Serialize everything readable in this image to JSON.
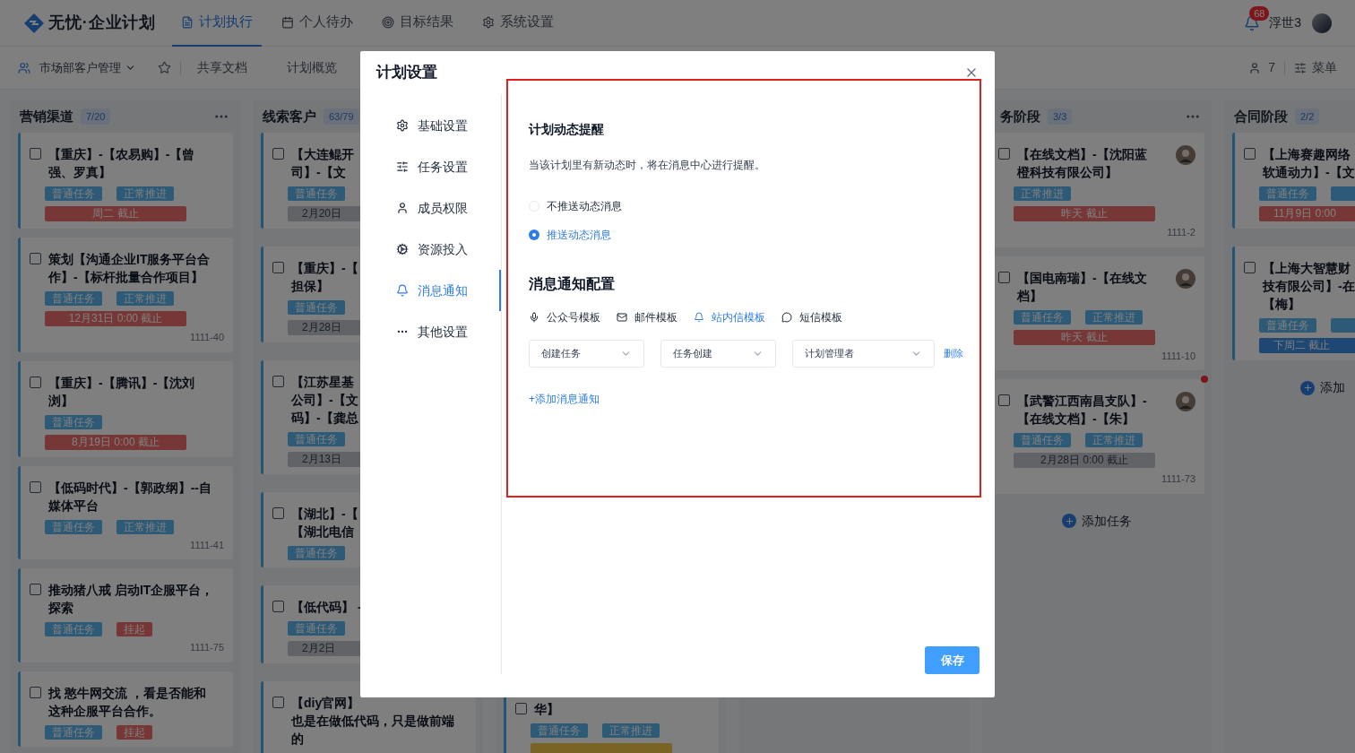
{
  "header": {
    "logo": "无忧·企业计划",
    "nav": [
      {
        "label": "计划执行",
        "selected": true
      },
      {
        "label": "个人待办",
        "selected": false
      },
      {
        "label": "目标结果",
        "selected": false
      },
      {
        "label": "系统设置",
        "selected": false
      }
    ],
    "badge": "68",
    "user": "浮世3"
  },
  "subbar": {
    "project": "市场部客户管理",
    "links": [
      "共享文档",
      "计划概览"
    ],
    "members": "7",
    "menu": "菜单"
  },
  "columns": [
    {
      "kind": "full",
      "title": "营销渠道",
      "count": "7/20",
      "more_button": true,
      "cards": [
        {
          "checked": false,
          "lines": [
            "【重庆】-【农易购】-【曾",
            "强、罗真】"
          ],
          "tags": [
            {
              "text": "普通任务",
              "kind": "normal"
            },
            {
              "text": "正常推进",
              "kind": "normal"
            }
          ],
          "due": {
            "text": "周二 截止",
            "kind": "red"
          }
        },
        {
          "checked": false,
          "lines": [
            "策划【沟通企业IT服务平台合",
            "作】-【标杆批量合作项目】"
          ],
          "tags": [
            {
              "text": "普通任务",
              "kind": "normal"
            },
            {
              "text": "正常推进",
              "kind": "normal"
            }
          ],
          "due": {
            "text": "12月31日 0:00 截止",
            "kind": "red"
          },
          "code": "1111-40"
        },
        {
          "checked": false,
          "lines": [
            "【重庆】-【腾讯】-【沈刘",
            "浏】"
          ],
          "tags": [
            {
              "text": "普通任务",
              "kind": "normal"
            }
          ],
          "due": {
            "text": "8月19日 0:00 截止",
            "kind": "red"
          }
        },
        {
          "checked": false,
          "lines": [
            "【低码时代】-【郭政纲】--自",
            "媒体平台"
          ],
          "tags": [
            {
              "text": "普通任务",
              "kind": "normal"
            },
            {
              "text": "正常推进",
              "kind": "normal"
            }
          ],
          "code": "1111-41"
        },
        {
          "checked": false,
          "lines": [
            "推动猪八戒 启动IT企服平台，",
            "探索"
          ],
          "tags": [
            {
              "text": "普通任务",
              "kind": "normal"
            },
            {
              "text": "挂起",
              "kind": "paused"
            }
          ],
          "code": "1111-75"
        },
        {
          "checked": false,
          "lines": [
            "找 憨牛网交流 ，看是否能和",
            "这种企服平台合作。"
          ],
          "tags": [
            {
              "text": "普通任务",
              "kind": "normal"
            },
            {
              "text": "挂起",
              "kind": "paused"
            }
          ]
        }
      ]
    },
    {
      "kind": "clipped_right",
      "title": "线索客户",
      "count": "63/79",
      "cards": [
        {
          "checked": false,
          "lines": [
            "【大连鲲开",
            "司】-【文"
          ],
          "tags": [
            {
              "text": "普通任务",
              "kind": "normal"
            }
          ],
          "due": {
            "text": "2月20日",
            "kind": "gray"
          }
        },
        {
          "checked": false,
          "lines": [
            "【重庆】-【",
            "担保】"
          ],
          "tags": [
            {
              "text": "普通任务",
              "kind": "normal"
            }
          ],
          "due": {
            "text": "2月28日",
            "kind": "gray"
          }
        },
        {
          "checked": false,
          "lines": [
            "【江苏星基",
            "公司】-【文",
            "码】-【龚总"
          ],
          "tags": [
            {
              "text": "普通任务",
              "kind": "normal"
            }
          ],
          "due": {
            "text": "2月13日",
            "kind": "gray"
          }
        },
        {
          "checked": false,
          "lines": [
            "【湖北】-【",
            "【湖北电信"
          ],
          "tags": [
            {
              "text": "普通任务",
              "kind": "normal"
            }
          ]
        },
        {
          "checked": false,
          "lines": [
            "【低代码】 -"
          ],
          "tags": [
            {
              "text": "普通任务",
              "kind": "normal"
            }
          ],
          "due": {
            "text": "2月2日",
            "kind": "gray"
          }
        },
        {
          "checked": false,
          "lines": [
            "【diy官网】",
            "也是在做低代码，只是做前端",
            "的"
          ]
        }
      ]
    },
    {
      "kind": "bottom_fragment",
      "cards": [
        {
          "checked": false,
          "lines": [
            "华】"
          ],
          "tags": [
            {
              "text": "普通任务",
              "kind": "normal"
            },
            {
              "text": "正常推进",
              "kind": "normal"
            }
          ],
          "due": {
            "kind": "yellow"
          }
        }
      ]
    },
    {
      "kind": "empty"
    },
    {
      "kind": "clipped_left",
      "title": "务阶段",
      "count": "3/3",
      "more_button": true,
      "cards": [
        {
          "checked": false,
          "lines": [
            "【在线文档】-【沈阳蓝",
            "橙科技有限公司】"
          ],
          "assignee_avatar": true,
          "unread": false,
          "tags": [
            {
              "text": "正常推进",
              "kind": "normal"
            }
          ],
          "due": {
            "text": "昨天 截止",
            "kind": "red"
          },
          "code": "1111-2"
        },
        {
          "checked": false,
          "lines": [
            "【国电南瑞】-【在线文",
            "档】"
          ],
          "assignee_avatar": true,
          "unread": false,
          "tags": [
            {
              "text": "普通任务",
              "kind": "normal"
            },
            {
              "text": "正常推进",
              "kind": "normal"
            }
          ],
          "due": {
            "text": "昨天 截止",
            "kind": "red"
          },
          "code": "1111-10"
        },
        {
          "checked": false,
          "lines": [
            "【武警江西南昌支队】-",
            "【在线文档】-【朱】"
          ],
          "assignee_avatar": true,
          "unread": true,
          "tags": [
            {
              "text": "普通任务",
              "kind": "normal"
            },
            {
              "text": "正常推进",
              "kind": "normal"
            }
          ],
          "due": {
            "text": "2月28日 0:00 截止",
            "kind": "gray"
          },
          "code": "1111-73"
        }
      ],
      "add": "添加任务"
    },
    {
      "kind": "clipped_right",
      "title": "合同阶段",
      "count": "2/2",
      "cards": [
        {
          "checked": false,
          "lines": [
            "【上海赛趣网络",
            "软通动力】-【文"
          ],
          "tags": [
            {
              "text": "普通任务",
              "kind": "normal"
            },
            {
              "kind": "normal"
            }
          ],
          "due": {
            "text": "11月9日 0:00",
            "kind": "red"
          }
        },
        {
          "checked": false,
          "lines": [
            "【上海大智慧财",
            "技有限公司】-在",
            "【梅】"
          ],
          "tags": [
            {
              "text": "普通任务",
              "kind": "normal"
            },
            {
              "kind": "normal"
            }
          ],
          "due": {
            "text": "下周二 截止",
            "kind": "blue"
          }
        }
      ],
      "add": "添加"
    }
  ],
  "modal": {
    "title": "计划设置",
    "menu": [
      {
        "label": "基础设置",
        "selected": false
      },
      {
        "label": "任务设置",
        "selected": false
      },
      {
        "label": "成员权限",
        "selected": false
      },
      {
        "label": "资源投入",
        "selected": false
      },
      {
        "label": "消息通知",
        "selected": true
      },
      {
        "label": "其他设置",
        "selected": false
      }
    ],
    "reminder": {
      "title": "计划动态提醒",
      "description": "当该计划里有新动态时，将在消息中心进行提醒。",
      "options": [
        {
          "label": "不推送动态消息",
          "selected": false
        },
        {
          "label": "推送动态消息",
          "selected": true
        }
      ]
    },
    "notify": {
      "title": "消息通知配置",
      "templates": [
        {
          "label": "公众号模板",
          "selected": false
        },
        {
          "label": "邮件模板",
          "selected": false
        },
        {
          "label": "站内信模板",
          "selected": true
        },
        {
          "label": "短信模板",
          "selected": false
        }
      ],
      "selects": [
        "创建任务",
        "任务创建",
        "计划管理者"
      ],
      "delete": "删除",
      "add": "+添加消息通知"
    },
    "save": "保存"
  }
}
